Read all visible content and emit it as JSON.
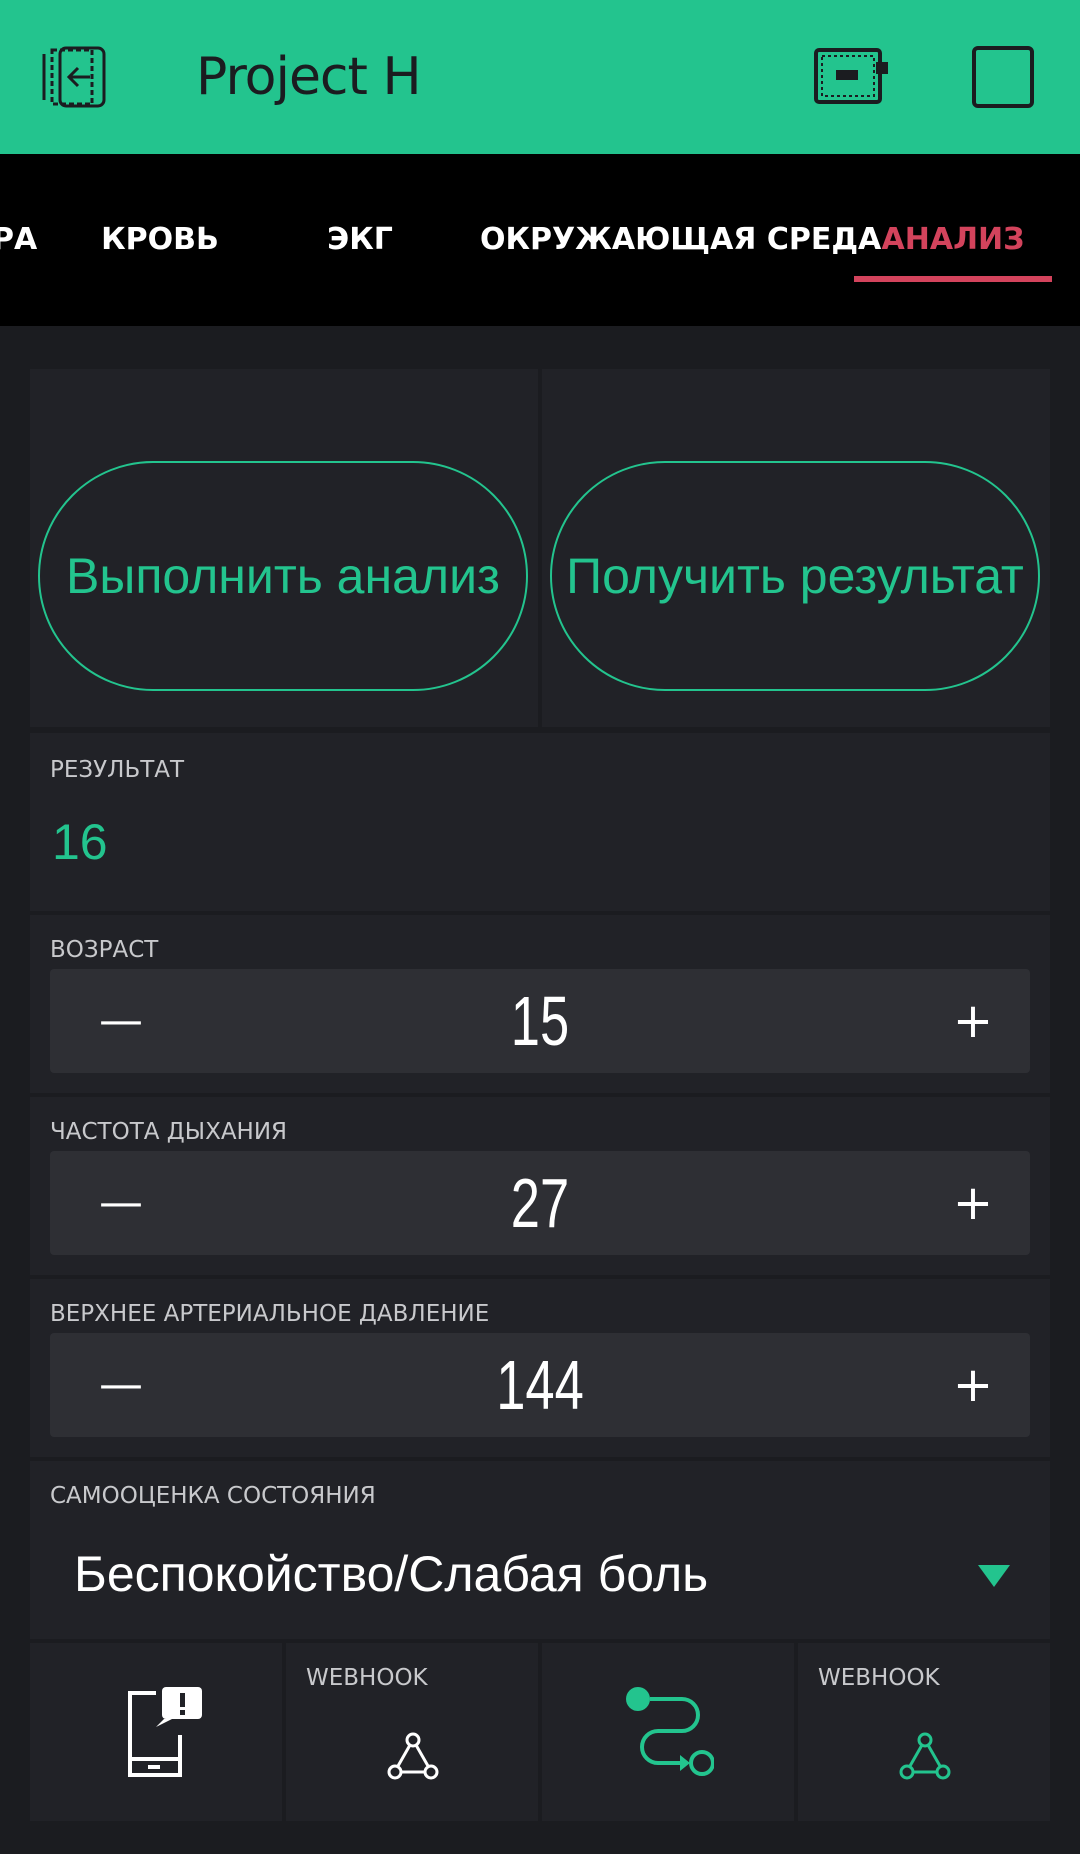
{
  "header": {
    "title": "Project H",
    "back_icon": "exit-icon",
    "device_icon": "device-icon",
    "menu_icon": "square-icon",
    "background": "#23c48e"
  },
  "tabs": [
    {
      "label": "РА"
    },
    {
      "label": "КРОВЬ"
    },
    {
      "label": "ЭКГ"
    },
    {
      "label": "ОКРУЖАЮЩАЯ СРЕДА"
    },
    {
      "label": "АНАЛИЗ",
      "active": true
    }
  ],
  "buttons": {
    "run_analysis": "Выполнить анализ",
    "get_result": "Получить результат"
  },
  "result": {
    "label": "РЕЗУЛЬТАТ",
    "value": "16"
  },
  "steppers": [
    {
      "label": "ВОЗРАСТ",
      "value": "15",
      "minus": "—",
      "plus": "+"
    },
    {
      "label": "ЧАСТОТА ДЫХАНИЯ",
      "value": "27",
      "minus": "—",
      "plus": "+"
    },
    {
      "label": "ВЕРХНЕЕ АРТЕРИАЛЬНОЕ ДАВЛЕНИЕ",
      "value": "144",
      "minus": "—",
      "plus": "+"
    }
  ],
  "menu": {
    "label": "САМООЦЕНКА СОСТОЯНИЯ",
    "value": "Беспокойство/Слабая боль"
  },
  "bottom": {
    "webhook1_label": "WEBHOOK",
    "webhook2_label": "WEBHOOK",
    "notification_icon": "notification-icon",
    "eventor_icon": "eventor-icon",
    "webhook_icon": "webhook-icon"
  },
  "colors": {
    "accent": "#23c48e",
    "active_tab": "#d3435c",
    "widget_bg": "#212227",
    "page_bg": "#1b1c20"
  }
}
